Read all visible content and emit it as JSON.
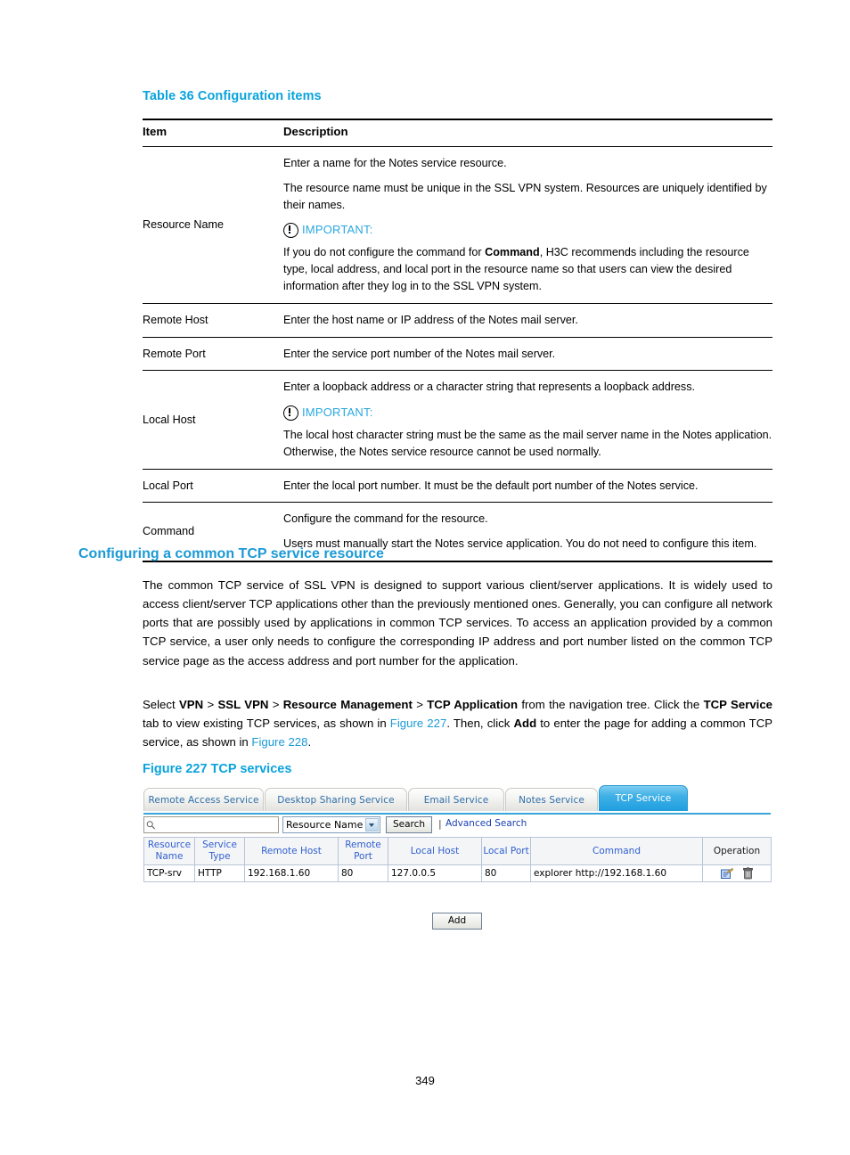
{
  "document": {
    "table_caption": "Table 36 Configuration items",
    "config_table": {
      "headers": {
        "item": "Item",
        "description": "Description"
      },
      "rows": [
        {
          "item": "Resource Name",
          "paragraphs": [
            "Enter a name for the Notes service resource.",
            "The resource name must be unique in the SSL VPN system. Resources are uniquely identified by their names."
          ],
          "important_label": "IMPORTANT:",
          "important_body_pre": "If you do not configure the command for ",
          "important_body_bold": "Command",
          "important_body_post": ", H3C recommends including the resource type, local address, and local port in the resource name so that users can view the desired information after they log in to the SSL VPN system."
        },
        {
          "item": "Remote Host",
          "paragraphs": [
            "Enter the host name or IP address of the Notes mail server."
          ]
        },
        {
          "item": "Remote Port",
          "paragraphs": [
            "Enter the service port number of the Notes mail server."
          ]
        },
        {
          "item": "Local Host",
          "paragraphs": [
            "Enter a loopback address or a character string that represents a loopback address."
          ],
          "important_label": "IMPORTANT:",
          "important_body": "The local host character string must be the same as the mail server name in the Notes application. Otherwise, the Notes service resource cannot be used normally."
        },
        {
          "item": "Local Port",
          "paragraphs": [
            "Enter the local port number. It must be the default port number of the Notes service."
          ]
        },
        {
          "item": "Command",
          "paragraphs": [
            "Configure the command for the resource.",
            "Users must manually start the Notes service application. You do not need to configure this item."
          ]
        }
      ]
    },
    "section_heading": "Configuring a common TCP service resource",
    "intro_paragraph": "The common TCP service of SSL VPN is designed to support various client/server applications. It is widely used to access client/server TCP applications other than the previously mentioned ones. Generally, you can configure all network ports that are possibly used by applications in common TCP services. To access an application provided by a common TCP service, a user only needs to configure the corresponding IP address and port number listed on the common TCP service page as the access address and port number for the application.",
    "select_paragraph": {
      "t1": "Select ",
      "b1": "VPN",
      "t2": " > ",
      "b2": "SSL VPN",
      "t3": " > ",
      "b3": "Resource Management",
      "t4": " > ",
      "b4": "TCP Application",
      "t5": " from the navigation tree. Click the ",
      "b5": "TCP Service",
      "t6": " tab to view existing TCP services, as shown in ",
      "x1": "Figure 227",
      "t7": ". Then, click ",
      "b6": "Add",
      "t8": " to enter the page for adding a common TCP service, as shown in ",
      "x2": "Figure 228",
      "t9": "."
    },
    "figure_caption": "Figure 227 TCP services",
    "page_number": "349"
  },
  "ui": {
    "tabs": [
      {
        "label": "Remote Access Service",
        "active": false
      },
      {
        "label": "Desktop Sharing Service",
        "active": false
      },
      {
        "label": "Email Service",
        "active": false
      },
      {
        "label": "Notes Service",
        "active": false
      },
      {
        "label": "TCP Service",
        "active": true
      }
    ],
    "search": {
      "icon": "search-icon",
      "value": "",
      "placeholder": "",
      "field_select": "Resource Name",
      "search_button": "Search",
      "separator": "|",
      "advanced_search": "Advanced Search"
    },
    "grid": {
      "headers": [
        "Resource Name",
        "Service Type",
        "Remote Host",
        "Remote Port",
        "Local Host",
        "Local Port",
        "Command",
        "Operation"
      ],
      "rows": [
        {
          "resource_name": "TCP-srv",
          "service_type": "HTTP",
          "remote_host": "192.168.1.60",
          "remote_port": "80",
          "local_host": "127.0.0.5",
          "local_port": "80",
          "command": "explorer http://192.168.1.60",
          "operations": [
            "edit-icon",
            "delete-icon"
          ]
        }
      ]
    },
    "add_button": "Add",
    "colors": {
      "tab_active": "#1f9fe0",
      "tab_text": "#2f6fa8",
      "grid_header_text": "#2f5fd0",
      "link": "#1a3fb0"
    }
  }
}
